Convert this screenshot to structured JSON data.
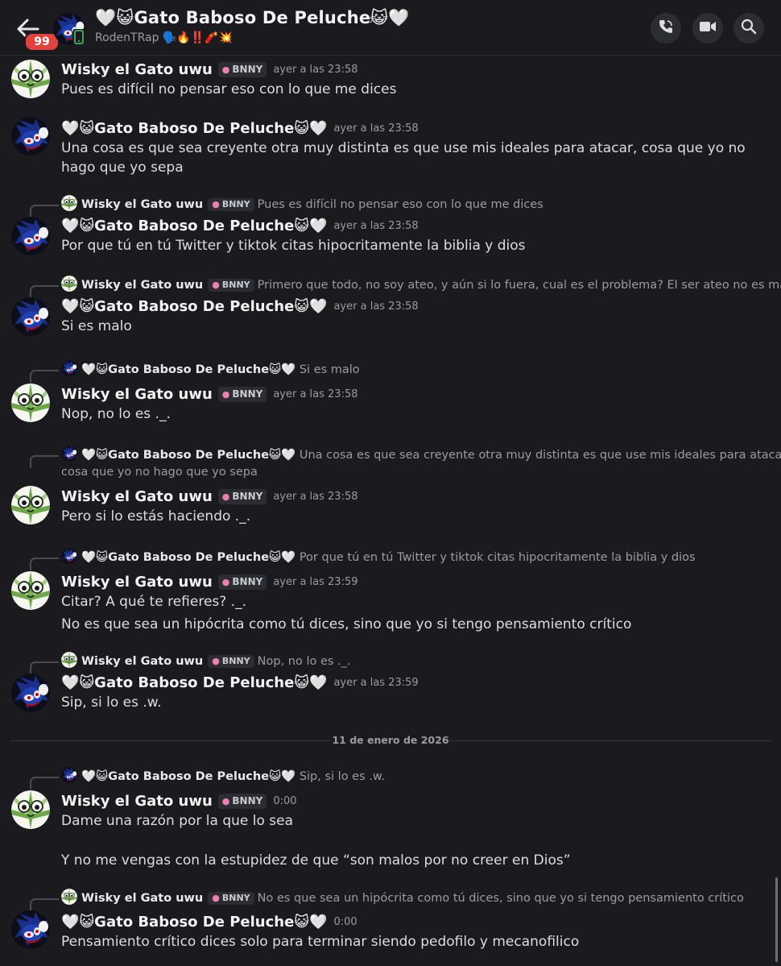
{
  "header": {
    "badge": "99",
    "title": "🤍😺Gato Baboso De Peluche😺🤍",
    "subtitle": "RodenTRap 🗣️🔥‼️🧨💥",
    "chevron": "›",
    "icons": [
      "back-arrow-icon",
      "phone-call-icon",
      "video-camera-icon",
      "search-icon"
    ]
  },
  "users": {
    "wisky": "Wisky el Gato uwu",
    "gato": "🤍😺Gato Baboso De Peluche😺🤍",
    "tag": "BNNY"
  },
  "date_divider": "11 de enero de 2026",
  "messages": [
    {
      "author": "Wisky el Gato uwu",
      "tag": "BNNY",
      "time": "ayer a las 23:58",
      "lines": [
        "Pues es difícil no pensar eso con lo que me dices"
      ]
    },
    {
      "author": "🤍😺Gato Baboso De Peluche😺🤍",
      "time": "ayer a las 23:58",
      "lines": [
        "Una cosa es que sea creyente otra muy distinta es que use mis ideales para atacar, cosa que yo no hago que yo sepa"
      ]
    },
    {
      "reply_author": "Wisky el Gato uwu",
      "reply_tag": "BNNY",
      "reply_text": "Pues es difícil no pensar eso con lo que me dices",
      "author": "🤍😺Gato Baboso De Peluche😺🤍",
      "time": "ayer a las 23:58",
      "lines": [
        "Por que tú en tú Twitter y tiktok citas hipocritamente la biblia y dios"
      ]
    },
    {
      "reply_author": "Wisky el Gato uwu",
      "reply_tag": "BNNY",
      "reply_text": "Primero que todo, no soy ateo, y aún si lo fuera, cual es el problema? El ser ateo no es malo :^",
      "author": "🤍😺Gato Baboso De Peluche😺🤍",
      "time": "ayer a las 23:58",
      "lines": [
        "Si es malo"
      ]
    },
    {
      "reply_author": "🤍😺Gato Baboso De Peluche😺🤍",
      "reply_text": "Si es malo",
      "author": "Wisky el Gato uwu",
      "tag": "BNNY",
      "time": "ayer a las 23:58",
      "lines": [
        "Nop, no lo es ._."
      ]
    },
    {
      "reply_author": "🤍😺Gato Baboso De Peluche😺🤍",
      "reply_text": "Una cosa es que sea creyente otra muy distinta es que use mis ideales para atacar,",
      "reply_text2": "cosa que yo no hago que yo sepa",
      "author": "Wisky el Gato uwu",
      "tag": "BNNY",
      "time": "ayer a las 23:58",
      "lines": [
        "Pero si lo estás haciendo ._."
      ]
    },
    {
      "reply_author": "🤍😺Gato Baboso De Peluche😺🤍",
      "reply_text": "Por que tú en tú Twitter y tiktok citas hipocritamente la biblia y dios",
      "author": "Wisky el Gato uwu",
      "tag": "BNNY",
      "time": "ayer a las 23:59",
      "lines": [
        "Citar? A qué te refieres? ._.",
        "No es que sea un hipócrita como tú dices, sino que yo si tengo pensamiento crítico"
      ]
    },
    {
      "reply_author": "Wisky el Gato uwu",
      "reply_tag": "BNNY",
      "reply_text": "Nop, no lo es ._.",
      "author": "🤍😺Gato Baboso De Peluche😺🤍",
      "time": "ayer a las 23:59",
      "lines": [
        "Sip, si lo es .w."
      ]
    },
    {
      "reply_author": "🤍😺Gato Baboso De Peluche😺🤍",
      "reply_text": "Sip, si lo es .w.",
      "author": "Wisky el Gato uwu",
      "tag": "BNNY",
      "time": "0:00",
      "lines": [
        "Dame una razón por la que lo sea",
        "Y no me vengas con la estupidez de que “son malos por no creer en Dios”"
      ]
    },
    {
      "reply_author": "Wisky el Gato uwu",
      "reply_tag": "BNNY",
      "reply_text": "No es que sea un hipócrita como tú dices, sino que yo si tengo pensamiento crítico",
      "author": "🤍😺Gato Baboso De Peluche😺🤍",
      "time": "0:00",
      "lines": [
        "Pensamiento crítico dices solo para terminar siendo pedofilo y mecanofilico"
      ]
    }
  ]
}
